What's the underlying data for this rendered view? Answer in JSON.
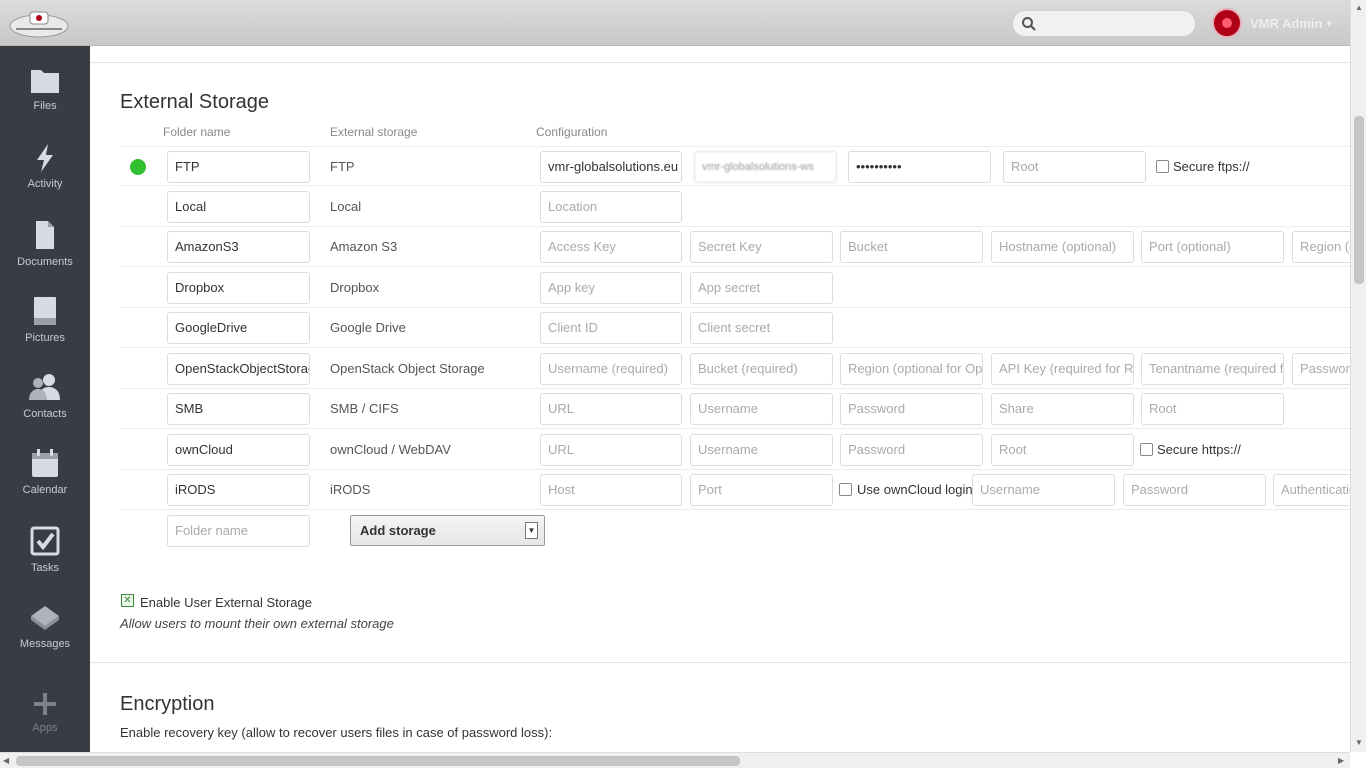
{
  "header": {
    "logo_alt": "VMR Global Solutions",
    "search_placeholder": "",
    "user_name": "VMR Admin",
    "user_caret": "▾"
  },
  "nav": [
    {
      "label": "Files",
      "icon": "folder-icon"
    },
    {
      "label": "Activity",
      "icon": "bolt-icon"
    },
    {
      "label": "Documents",
      "icon": "document-icon"
    },
    {
      "label": "Pictures",
      "icon": "picture-icon"
    },
    {
      "label": "Contacts",
      "icon": "people-icon"
    },
    {
      "label": "Calendar",
      "icon": "calendar-icon"
    },
    {
      "label": "Tasks",
      "icon": "checkbox-icon"
    },
    {
      "label": "Messages",
      "icon": "envelope-icon"
    },
    {
      "label": "Apps",
      "icon": "plus-icon"
    }
  ],
  "external_storage": {
    "title": "External Storage",
    "col_folder": "Folder name",
    "col_storage": "External storage",
    "col_config": "Configuration",
    "rows": [
      {
        "folder": "FTP",
        "storage": "FTP",
        "status": "green",
        "config": [
          "vmr-globalsolutions.eu",
          "vmr-globalsolutions-ws",
          "••••••••••",
          "Root"
        ],
        "check": "Secure ftps://"
      },
      {
        "folder": "Local",
        "storage": "Local",
        "config": [
          "Location"
        ]
      },
      {
        "folder": "AmazonS3",
        "storage": "Amazon S3",
        "config": [
          "Access Key",
          "Secret Key",
          "Bucket",
          "Hostname (optional)",
          "Port (optional)",
          "Region (optional)"
        ]
      },
      {
        "folder": "Dropbox",
        "storage": "Dropbox",
        "config": [
          "App key",
          "App secret"
        ]
      },
      {
        "folder": "GoogleDrive",
        "storage": "Google Drive",
        "config": [
          "Client ID",
          "Client secret"
        ]
      },
      {
        "folder": "OpenStackObjectStorage",
        "storage": "OpenStack Object Storage",
        "config": [
          "Username (required)",
          "Bucket (required)",
          "Region (optional for OpenStack Object Storage)",
          "API Key (required for Rackspace Cloud Files)",
          "Tenantname (required for OpenStack Object Storage)",
          "Password"
        ]
      },
      {
        "folder": "SMB",
        "storage": "SMB / CIFS",
        "config": [
          "URL",
          "Username",
          "Password",
          "Share",
          "Root"
        ]
      },
      {
        "folder": "ownCloud",
        "storage": "ownCloud / WebDAV",
        "config": [
          "URL",
          "Username",
          "Password",
          "Root"
        ],
        "check": "Secure https://"
      },
      {
        "folder": "iRODS",
        "storage": "iRODS",
        "config": [
          "Host",
          "Port",
          "Username",
          "Password",
          "Authentication"
        ],
        "check": "Use ownCloud login"
      }
    ],
    "new_folder_placeholder": "Folder name",
    "add_storage_label": "Add storage",
    "enable_user_label": "Enable User External Storage",
    "enable_user_hint": "Allow users to mount their own external storage"
  },
  "encryption": {
    "title": "Encryption",
    "recovery_label": "Enable recovery key (allow to recover users files in case of password loss):"
  },
  "colors": {
    "sidebar": "#383c43",
    "status_ok": "#2fbf2f",
    "accent": "#b00018"
  }
}
